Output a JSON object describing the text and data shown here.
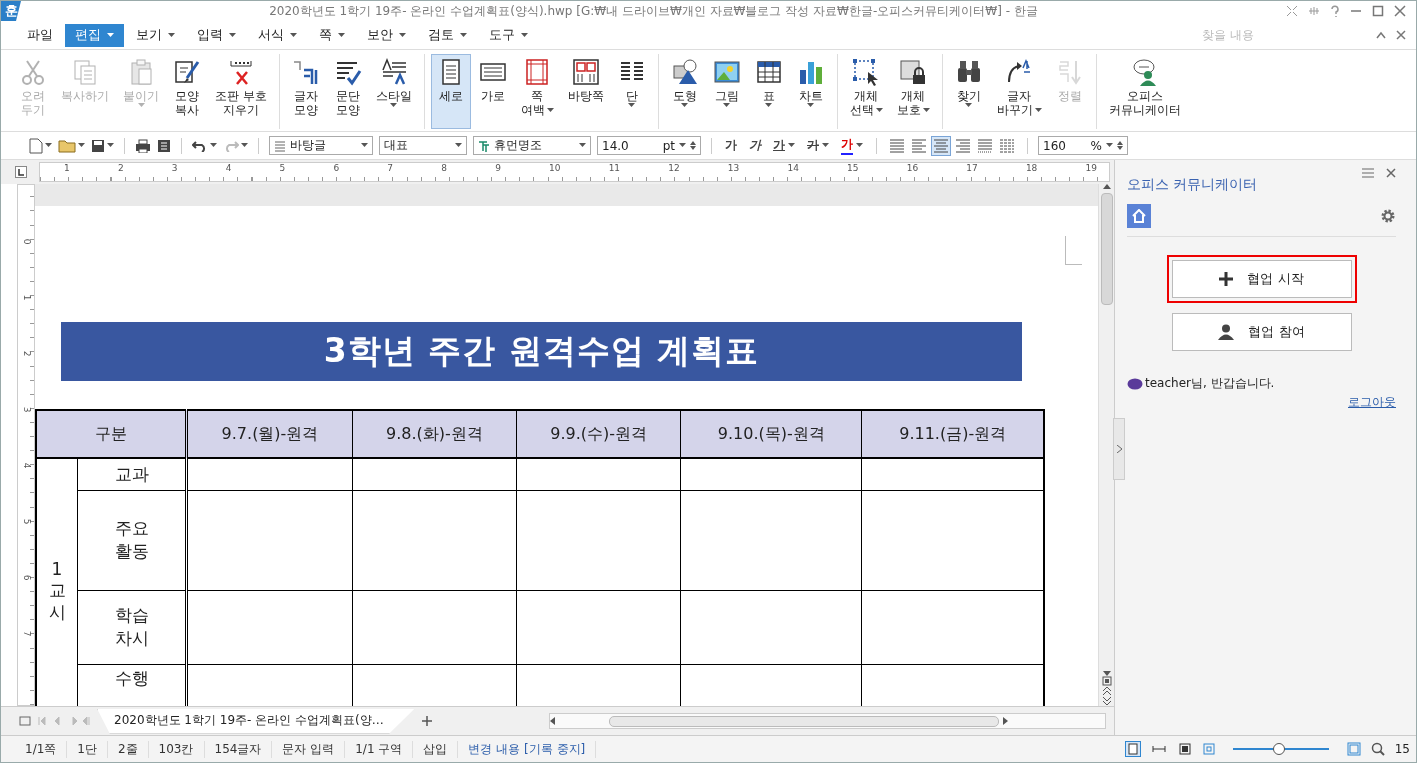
{
  "window": {
    "app_icon": "훈",
    "title": "2020학년도 1학기 19주- 온라인 수업계획표(양식).hwp [G:₩내 드라이브₩개인 자료₩블로그 작성 자료₩한글-오피스커뮤티케이터₩] - 한글"
  },
  "menu": [
    {
      "label": "파일",
      "dropdown": false,
      "selected": false
    },
    {
      "label": "편집",
      "dropdown": true,
      "selected": true
    },
    {
      "label": "보기",
      "dropdown": true,
      "selected": false
    },
    {
      "label": "입력",
      "dropdown": true,
      "selected": false
    },
    {
      "label": "서식",
      "dropdown": true,
      "selected": false
    },
    {
      "label": "쪽",
      "dropdown": true,
      "selected": false
    },
    {
      "label": "보안",
      "dropdown": true,
      "selected": false
    },
    {
      "label": "검토",
      "dropdown": true,
      "selected": false
    },
    {
      "label": "도구",
      "dropdown": true,
      "selected": false
    }
  ],
  "search": {
    "placeholder": "찾을 내용"
  },
  "ribbon": [
    [
      {
        "kind": "scissors",
        "lines": [
          "오려",
          "두기"
        ],
        "disabled": true,
        "dropdown": false,
        "selected": false
      },
      {
        "kind": "copy",
        "lines": [
          "복사하기"
        ],
        "disabled": true,
        "dropdown": false,
        "selected": false
      },
      {
        "kind": "paste",
        "lines": [
          "붙이기"
        ],
        "disabled": true,
        "dropdown": true,
        "selected": false
      },
      {
        "kind": "brush",
        "lines": [
          "모양",
          "복사"
        ],
        "disabled": false,
        "dropdown": false,
        "selected": false
      },
      {
        "kind": "codes",
        "lines": [
          "조판 부호",
          "지우기"
        ],
        "disabled": false,
        "dropdown": false,
        "selected": false
      }
    ],
    [
      {
        "kind": "charshape",
        "lines": [
          "글자",
          "모양"
        ],
        "disabled": false,
        "dropdown": false,
        "selected": false
      },
      {
        "kind": "parashape",
        "lines": [
          "문단",
          "모양"
        ],
        "disabled": false,
        "dropdown": false,
        "selected": false
      },
      {
        "kind": "style",
        "lines": [
          "스타일"
        ],
        "disabled": false,
        "dropdown": true,
        "selected": false
      }
    ],
    [
      {
        "kind": "portrait",
        "lines": [
          "세로"
        ],
        "disabled": false,
        "dropdown": false,
        "selected": true
      },
      {
        "kind": "landscape",
        "lines": [
          "가로"
        ],
        "disabled": false,
        "dropdown": false,
        "selected": false
      },
      {
        "kind": "margins",
        "lines": [
          "쪽",
          "여백"
        ],
        "disabled": false,
        "dropdown": true,
        "selected": false
      },
      {
        "kind": "master",
        "lines": [
          "바탕쪽"
        ],
        "disabled": false,
        "dropdown": false,
        "selected": false
      },
      {
        "kind": "columns",
        "lines": [
          "단"
        ],
        "disabled": false,
        "dropdown": true,
        "selected": false
      }
    ],
    [
      {
        "kind": "shape",
        "lines": [
          "도형"
        ],
        "disabled": false,
        "dropdown": true,
        "selected": false
      },
      {
        "kind": "picture",
        "lines": [
          "그림"
        ],
        "disabled": false,
        "dropdown": true,
        "selected": false
      },
      {
        "kind": "table",
        "lines": [
          "표"
        ],
        "disabled": false,
        "dropdown": true,
        "selected": false
      },
      {
        "kind": "chart",
        "lines": [
          "차트"
        ],
        "disabled": false,
        "dropdown": true,
        "selected": false
      }
    ],
    [
      {
        "kind": "select",
        "lines": [
          "개체",
          "선택"
        ],
        "disabled": false,
        "dropdown": true,
        "selected": false
      },
      {
        "kind": "protect",
        "lines": [
          "개체",
          "보호"
        ],
        "disabled": false,
        "dropdown": true,
        "selected": false
      }
    ],
    [
      {
        "kind": "find",
        "lines": [
          "찾기"
        ],
        "disabled": false,
        "dropdown": true,
        "selected": false
      },
      {
        "kind": "replace",
        "lines": [
          "글자",
          "바꾸기"
        ],
        "disabled": false,
        "dropdown": true,
        "selected": false
      },
      {
        "kind": "sort",
        "lines": [
          "정렬"
        ],
        "disabled": true,
        "dropdown": false,
        "selected": false
      }
    ],
    [
      {
        "kind": "communicator",
        "lines": [
          "오피스",
          "커뮤니케이터"
        ],
        "disabled": false,
        "dropdown": false,
        "selected": false
      }
    ]
  ],
  "toolbar": {
    "style": "바탕글",
    "outline": "대표",
    "font": "휴먼명조",
    "size": "14.0",
    "unit": "pt",
    "format_buttons": [
      {
        "kind": "bold",
        "label": "가",
        "dropdown": false
      },
      {
        "kind": "italic",
        "label": "가",
        "dropdown": false
      },
      {
        "kind": "underline",
        "label": "가",
        "dropdown": true
      },
      {
        "kind": "strike",
        "label": "가",
        "dropdown": true
      },
      {
        "kind": "color",
        "label": "가",
        "dropdown": true
      }
    ],
    "align_buttons": [
      {
        "kind": "justify",
        "selected": false
      },
      {
        "kind": "left",
        "selected": false
      },
      {
        "kind": "center",
        "selected": true
      },
      {
        "kind": "right",
        "selected": false
      },
      {
        "kind": "distribute",
        "selected": false
      },
      {
        "kind": "divide",
        "selected": false
      }
    ],
    "zoom": "160",
    "zoom_unit": "%"
  },
  "ruler": {
    "horizontal": [
      "1",
      "2",
      "3",
      "4",
      "5",
      "6",
      "7",
      "8",
      "9",
      "10",
      "11",
      "12",
      "13",
      "14",
      "15",
      "16",
      "17",
      "18",
      "19"
    ],
    "vertical": [
      "0",
      "1",
      "2",
      "3",
      "4",
      "5",
      "6",
      "7"
    ]
  },
  "document": {
    "banner": "3학년 주간 원격수업 계획표",
    "table": {
      "columns": [
        "구분",
        "9.7.(월)-원격",
        "9.8.(화)-원격",
        "9.9.(수)-원격",
        "9.10.(목)-원격",
        "9.11.(금)-원격"
      ],
      "period": "1교시",
      "rows": [
        {
          "label": [
            "교과"
          ]
        },
        {
          "label": [
            "주요",
            "활동"
          ]
        },
        {
          "label": [
            "학습",
            "차시"
          ]
        },
        {
          "label": [
            "수행"
          ]
        }
      ]
    }
  },
  "doc_tabs": [
    {
      "title": "2020학년도 1학기 19주- 온라인 수업계획표(양…",
      "selected": true
    }
  ],
  "panel": {
    "title": "오피스 커뮤니케이터",
    "buttons": [
      {
        "kind": "start",
        "label": "협업 시작",
        "highlighted": true
      },
      {
        "kind": "join",
        "label": "협업 참여",
        "highlighted": false
      }
    ],
    "greeting": "teacher님, 반갑습니다.",
    "logout": "로그아웃"
  },
  "status_bar": {
    "items": [
      "1/1쪽",
      "1단",
      "2줄",
      "103칸",
      "154글자",
      "문자 입력",
      "1/1 구역",
      "삽입"
    ],
    "tracking": "변경 내용 [기록 중지]",
    "zoom_slider": {
      "level": 0.48
    },
    "zoom": "15"
  }
}
